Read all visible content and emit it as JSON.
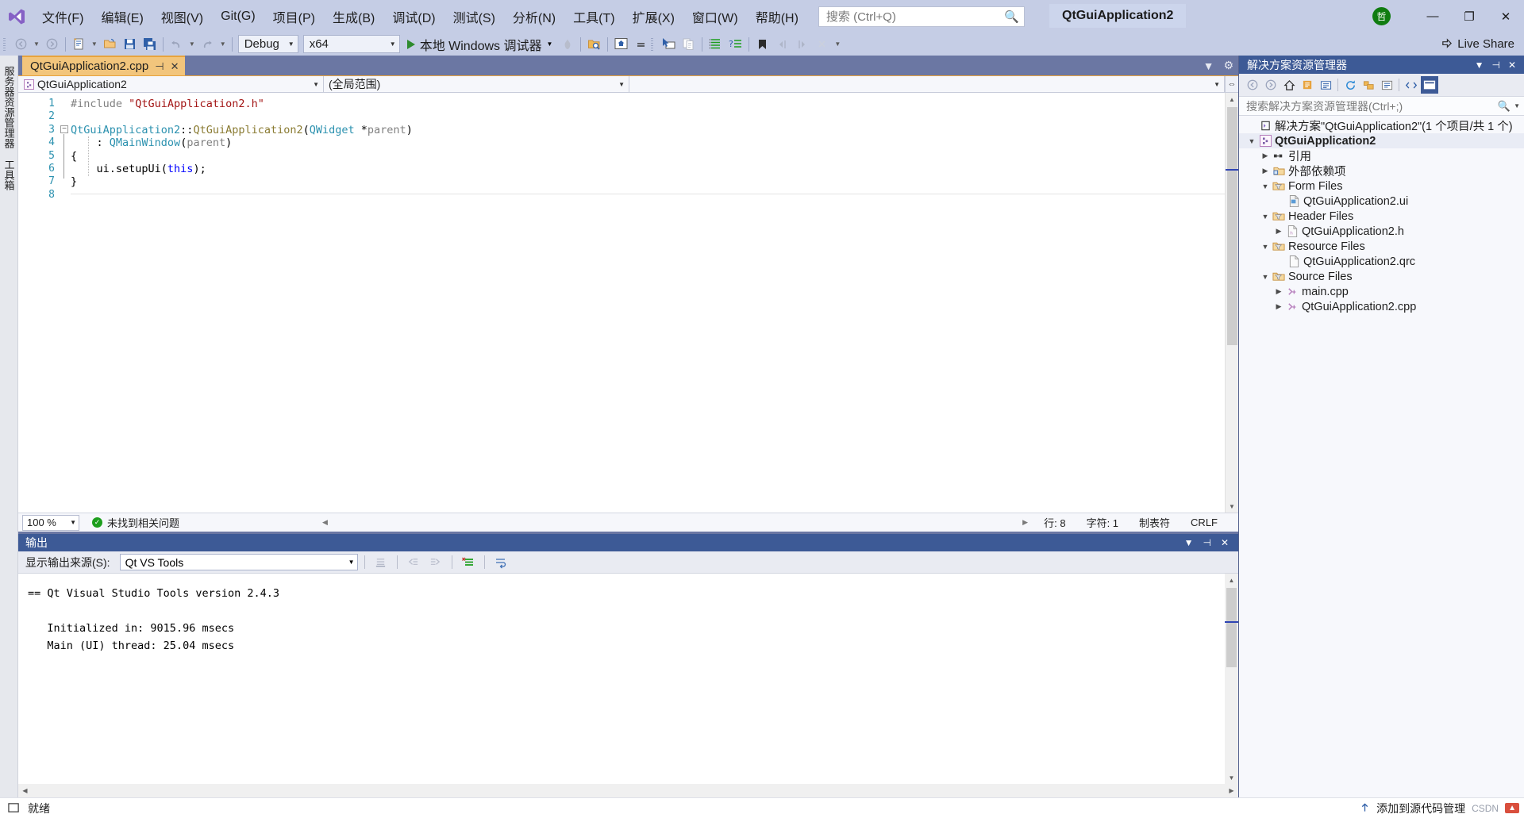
{
  "window": {
    "project_title": "QtGuiApplication2",
    "account_initial": "哲",
    "minimize": "—",
    "maximize": "❐",
    "close": "✕"
  },
  "menu": {
    "items": [
      {
        "label": "文件(F)"
      },
      {
        "label": "编辑(E)"
      },
      {
        "label": "视图(V)"
      },
      {
        "label": "Git(G)"
      },
      {
        "label": "项目(P)"
      },
      {
        "label": "生成(B)"
      },
      {
        "label": "调试(D)"
      },
      {
        "label": "测试(S)"
      },
      {
        "label": "分析(N)"
      },
      {
        "label": "工具(T)"
      },
      {
        "label": "扩展(X)"
      },
      {
        "label": "窗口(W)"
      },
      {
        "label": "帮助(H)"
      }
    ],
    "search_placeholder": "搜索 (Ctrl+Q)"
  },
  "toolbar": {
    "config": "Debug",
    "platform": "x64",
    "run_label": "本地 Windows 调试器",
    "live_share": "Live Share"
  },
  "editor": {
    "tab_label": "QtGuiApplication2.cpp",
    "tab_pin": "⊣",
    "tab_close": "✕",
    "nav_project": "QtGuiApplication2",
    "nav_scope": "(全局范围)",
    "nav_member": "",
    "lines": [
      "1",
      "2",
      "3",
      "4",
      "5",
      "6",
      "7",
      "8"
    ],
    "code": {
      "l1_pp": "#include ",
      "l1_str": "\"QtGuiApplication2.h\"",
      "l3_a": "QtGuiApplication2",
      "l3_b": "::",
      "l3_c": "QtGuiApplication2",
      "l3_d": "(",
      "l3_e": "QWidget",
      "l3_f": " *",
      "l3_g": "parent",
      "l3_h": ")",
      "l4_a": "    : ",
      "l4_b": "QMainWindow",
      "l4_c": "(",
      "l4_d": "parent",
      "l4_e": ")",
      "l5": "{",
      "l6_a": "    ui.setupUi(",
      "l6_b": "this",
      "l6_c": ");",
      "l7": "}"
    },
    "status": {
      "zoom": "100 %",
      "problems": "未找到相关问题",
      "line": "行: 8",
      "col": "字符: 1",
      "tabs": "制表符",
      "eol": "CRLF"
    }
  },
  "output": {
    "title": "输出",
    "source_label": "显示输出来源(S):",
    "source_value": "Qt VS Tools",
    "text": "== Qt Visual Studio Tools version 2.4.3\n\n   Initialized in: 9015.96 msecs\n   Main (UI) thread: 25.04 msecs"
  },
  "solution_explorer": {
    "title": "解决方案资源管理器",
    "search_placeholder": "搜索解决方案资源管理器(Ctrl+;)",
    "tree": [
      {
        "indent": 0,
        "twist": "",
        "icon": "solution-icon",
        "label": "解决方案\"QtGuiApplication2\"(1 个项目/共 1 个)",
        "bold": false
      },
      {
        "indent": 1,
        "twist": "▼",
        "icon": "project-icon",
        "label": "QtGuiApplication2",
        "bold": true
      },
      {
        "indent": 2,
        "twist": "▶",
        "icon": "references-icon",
        "label": "引用",
        "bold": false
      },
      {
        "indent": 2,
        "twist": "▶",
        "icon": "folder-dep-icon",
        "label": "外部依赖项",
        "bold": false
      },
      {
        "indent": 2,
        "twist": "▼",
        "icon": "filter-folder-icon",
        "label": "Form Files",
        "bold": false
      },
      {
        "indent": 3,
        "twist": "",
        "icon": "ui-file-icon",
        "label": "QtGuiApplication2.ui",
        "bold": false
      },
      {
        "indent": 2,
        "twist": "▼",
        "icon": "filter-folder-icon",
        "label": "Header Files",
        "bold": false
      },
      {
        "indent": 3,
        "twist": "▶",
        "icon": "h-file-icon",
        "label": "QtGuiApplication2.h",
        "bold": false
      },
      {
        "indent": 2,
        "twist": "▼",
        "icon": "filter-folder-icon",
        "label": "Resource Files",
        "bold": false
      },
      {
        "indent": 3,
        "twist": "",
        "icon": "qrc-file-icon",
        "label": "QtGuiApplication2.qrc",
        "bold": false
      },
      {
        "indent": 2,
        "twist": "▼",
        "icon": "filter-folder-icon",
        "label": "Source Files",
        "bold": false
      },
      {
        "indent": 3,
        "twist": "▶",
        "icon": "cpp-file-icon",
        "label": "main.cpp",
        "bold": false
      },
      {
        "indent": 3,
        "twist": "▶",
        "icon": "cpp-file-icon",
        "label": "QtGuiApplication2.cpp",
        "bold": false
      }
    ]
  },
  "left_rail": {
    "tabs": [
      "服务器资源管理器",
      "工具箱"
    ]
  },
  "statusbar": {
    "ready": "就绪",
    "source_control": "添加到源代码管理",
    "watermark": "CSDN"
  },
  "colors": {
    "chrome": "#c5cde5",
    "panel_header": "#3d5a96",
    "tab_active": "#f2c57c",
    "accent_blue": "#2b91af",
    "string_red": "#a31515",
    "keyword_blue": "#0000ff",
    "func_gold": "#8a7b32",
    "green_run": "#2e8b2e"
  }
}
